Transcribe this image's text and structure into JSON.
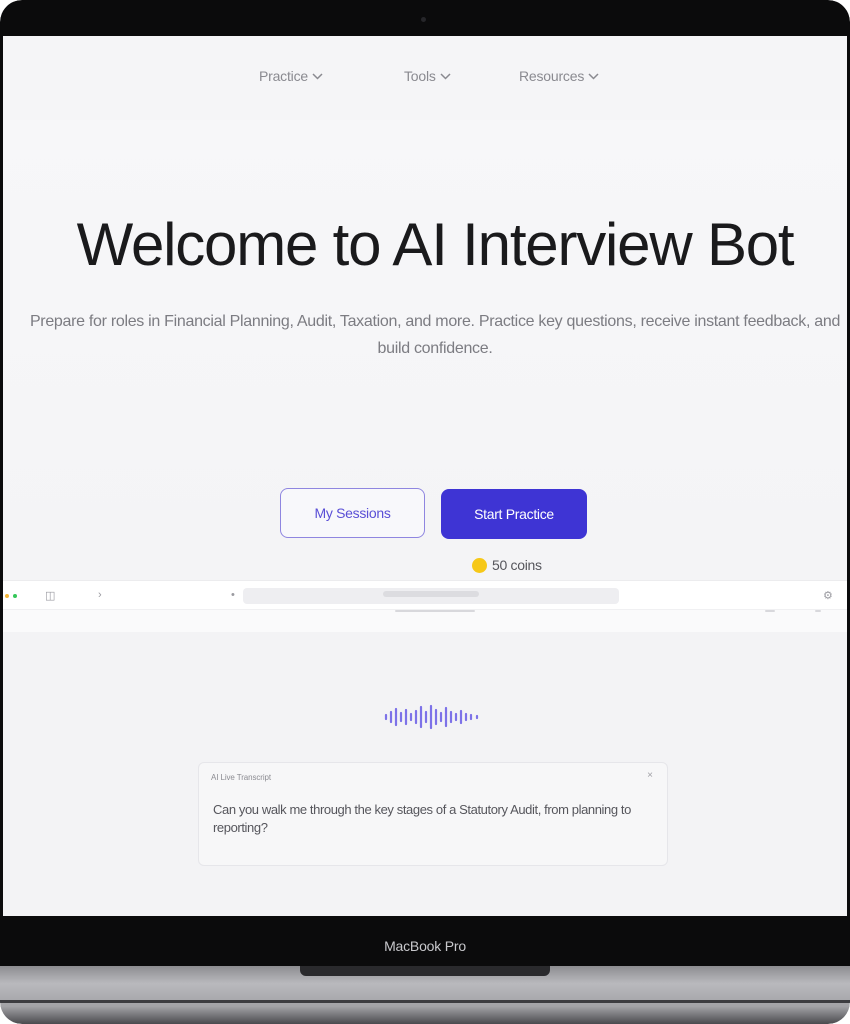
{
  "device": {
    "label": "MacBook Pro"
  },
  "nav": {
    "items": [
      {
        "label": "Practice",
        "icon": "chevron-down-icon"
      },
      {
        "label": "Tools",
        "icon": "chevron-down-icon"
      },
      {
        "label": "Resources",
        "icon": "chevron-down-icon"
      }
    ]
  },
  "hero": {
    "title": "Welcome to AI Interview Bot",
    "subtitle": "Prepare for roles in Financial Planning, Audit, Taxation, and more. Practice key questions, receive instant feedback, and build confidence."
  },
  "actions": {
    "sessions_label": "My Sessions",
    "start_label": "Start Practice"
  },
  "coins": {
    "label": "50 coins",
    "icon": "coin-icon"
  },
  "preview": {
    "transcript_label": "AI Live Transcript",
    "question": "Can you walk me through the key stages of a Statutory Audit, from planning to reporting?"
  },
  "colors": {
    "accent": "#3e34d4",
    "accent_outline": "#8f86e0",
    "coin": "#f6c818",
    "wave": "#7d72e8"
  }
}
